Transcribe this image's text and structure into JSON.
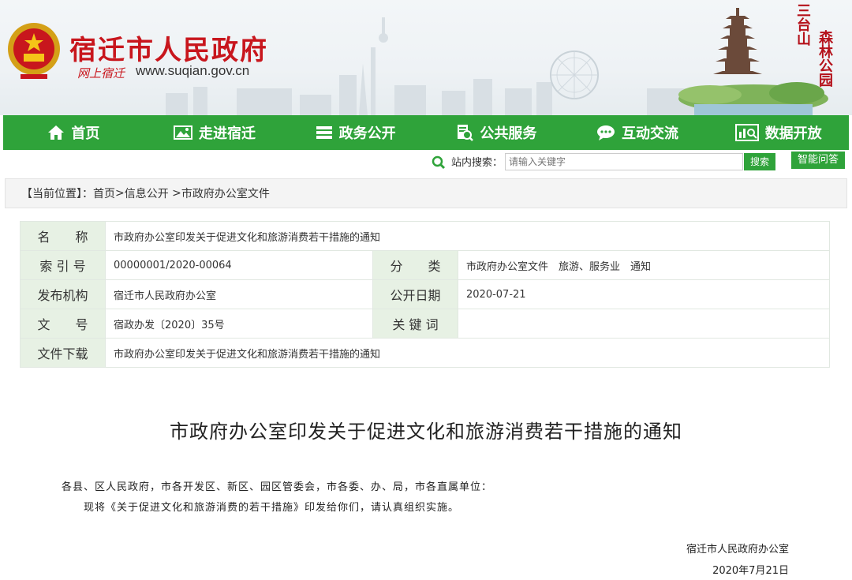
{
  "header": {
    "site_title": "宿迁市人民政府",
    "site_subtitle": "网上宿迁",
    "site_url": "www.suqian.gov.cn",
    "calligraphy_left": "三台山",
    "calligraphy_right": "森林公园"
  },
  "nav": {
    "items": [
      {
        "label": "首页",
        "icon": "home-icon"
      },
      {
        "label": "走进宿迁",
        "icon": "image-icon"
      },
      {
        "label": "政务公开",
        "icon": "list-icon"
      },
      {
        "label": "公共服务",
        "icon": "document-search-icon"
      },
      {
        "label": "互动交流",
        "icon": "chat-icon"
      },
      {
        "label": "数据开放",
        "icon": "data-chart-icon"
      }
    ]
  },
  "search": {
    "label": "站内搜索：",
    "placeholder": "请输入关键字",
    "button": "搜索",
    "ai_button": "智能问答"
  },
  "breadcrumb": {
    "prefix": "【当前位置】：",
    "home": "首页",
    "sep1": ">",
    "section": "信息公开",
    "sep2": " >",
    "current": "市政府办公室文件"
  },
  "info": {
    "name_label": "名　　称",
    "name_value": "市政府办公室印发关于促进文化和旅游消费若干措施的通知",
    "index_label": "索 引 号",
    "index_value": "00000001/2020-00064",
    "category_label": "分　　类",
    "category_value": "市政府办公室文件　旅游、服务业　通知",
    "org_label": "发布机构",
    "org_value": "宿迁市人民政府办公室",
    "date_label": "公开日期",
    "date_value": "2020-07-21",
    "docno_label": "文　　号",
    "docno_value": "宿政办发〔2020〕35号",
    "keyword_label": "关 键 词",
    "keyword_value": "",
    "download_label": "文件下载",
    "download_value": "市政府办公室印发关于促进文化和旅游消费若干措施的通知"
  },
  "document": {
    "title": "市政府办公室印发关于促进文化和旅游消费若干措施的通知",
    "recipients": "各县、区人民政府，市各开发区、新区、园区管委会，市各委、办、局，市各直属单位：",
    "body": "现将《关于促进文化和旅游消费的若干措施》印发给你们，请认真组织实施。",
    "signature": "宿迁市人民政府办公室",
    "date": "2020年7月21日"
  },
  "colors": {
    "brand_red": "#c8161d",
    "nav_green": "#2fa33a",
    "label_green_bg": "#e7f1e4"
  }
}
